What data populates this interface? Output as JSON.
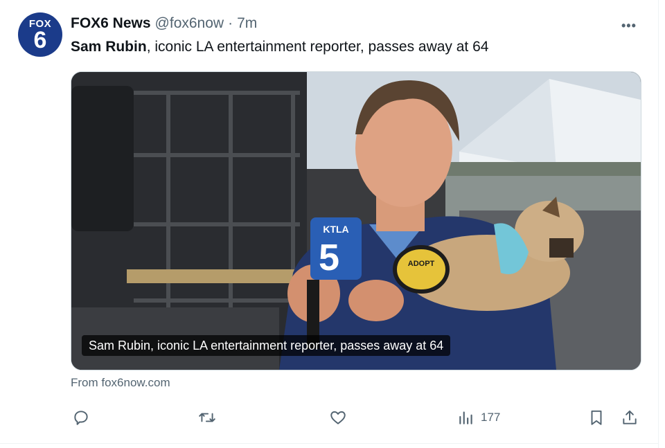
{
  "tweet": {
    "avatar": {
      "line1": "FOX",
      "line2": "6",
      "brand_color": "#1b3b8a"
    },
    "author_name": "FOX6 News",
    "handle": "@fox6now",
    "separator": "·",
    "time": "7m",
    "more_label": "•••",
    "text_bold": "Sam Rubin",
    "text_rest": ", iconic LA entertainment reporter, passes away at 64",
    "media": {
      "image_caption": "Sam Rubin, iconic LA entertainment reporter, passes away at 64",
      "mic_flag_top": "KTLA",
      "mic_flag_number": "5",
      "vest_patch": "ADOPT"
    },
    "source_text": "From fox6now.com",
    "actions": {
      "reply_icon": "reply-icon",
      "retweet_icon": "retweet-icon",
      "like_icon": "heart-icon",
      "views_icon": "views-bar-chart-icon",
      "views_count": "177",
      "bookmark_icon": "bookmark-icon",
      "share_icon": "share-icon"
    }
  }
}
